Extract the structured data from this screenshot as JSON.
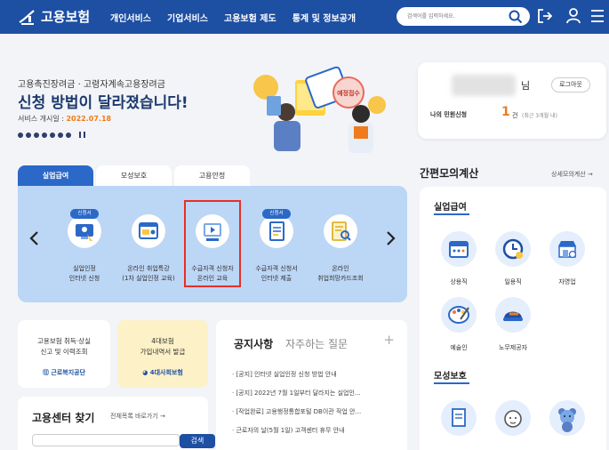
{
  "header": {
    "logo_text": "고용보험",
    "nav": [
      "개인서비스",
      "기업서비스",
      "고용보험 제도",
      "통계 및 정보공개"
    ],
    "search_placeholder": "검색어를 입력하세요."
  },
  "hero": {
    "subtitle": "고용촉진장려금 · 고령자계속고용장려금",
    "title": "신청 방법이 달라졌습니다!",
    "date_label": "서비스 개시일 : ",
    "date_value": "2022.07.18",
    "illustration_sign": "예정접수"
  },
  "user_panel": {
    "honorific": "님",
    "logout_label": "로그아웃",
    "claim_label": "나의 민원신청",
    "claim_count": "1",
    "claim_unit": "건",
    "claim_note": "(최근 3개월 내)"
  },
  "service_tabs": {
    "tabs": [
      "실업급여",
      "모성보호",
      "고용안정"
    ],
    "badge_label": "신청서",
    "items": [
      {
        "label": "실업인정\n인터넷 신청",
        "badge": true
      },
      {
        "label": "온라인 취업특강\n(1차 실업인정 교육)",
        "badge": false
      },
      {
        "label": "수급자격 신청자\n온라인 교육",
        "badge": false
      },
      {
        "label": "수급자격 신청서\n인터넷 제출",
        "badge": true
      },
      {
        "label": "온라인\n취업희망카드조회",
        "badge": false
      }
    ]
  },
  "cards": {
    "card1_text": "고용보험 취득·상실\n신고 및 이력조회",
    "card1_logo": "근로복지공단",
    "card2_text": "4대보험\n가입내역서 발급",
    "card2_logo": "4대사회보험"
  },
  "center": {
    "title": "고용센터 찾기",
    "link": "전체목록 바로가기 →",
    "button": "검색"
  },
  "notice": {
    "title": "공지사항",
    "faq_title": "자주하는 질문",
    "plus": "+",
    "items": [
      "[공지] 인터넷 실업인정 신청 방법 안내",
      "[공지] 2022년 7월 1일부터 달라지는 실업인...",
      "[작업완료] 고용행정통합포털 DB이관 작업 안...",
      "근로자의 날(5월 1일) 고객센터 휴무 안내"
    ]
  },
  "calc": {
    "title": "간편모의계산",
    "more": "상세모의계산 →",
    "section1": "실업급여",
    "items1": [
      "상용직",
      "일용직",
      "자영업",
      "예술인",
      "노무제공자"
    ],
    "section2": "모성보호"
  },
  "colors": {
    "header_bg": "#1d4fa3",
    "accent": "#2b68c8",
    "orange": "#f07b1d",
    "panel_blue": "#bcd6f5",
    "highlight_red": "#e63028"
  }
}
